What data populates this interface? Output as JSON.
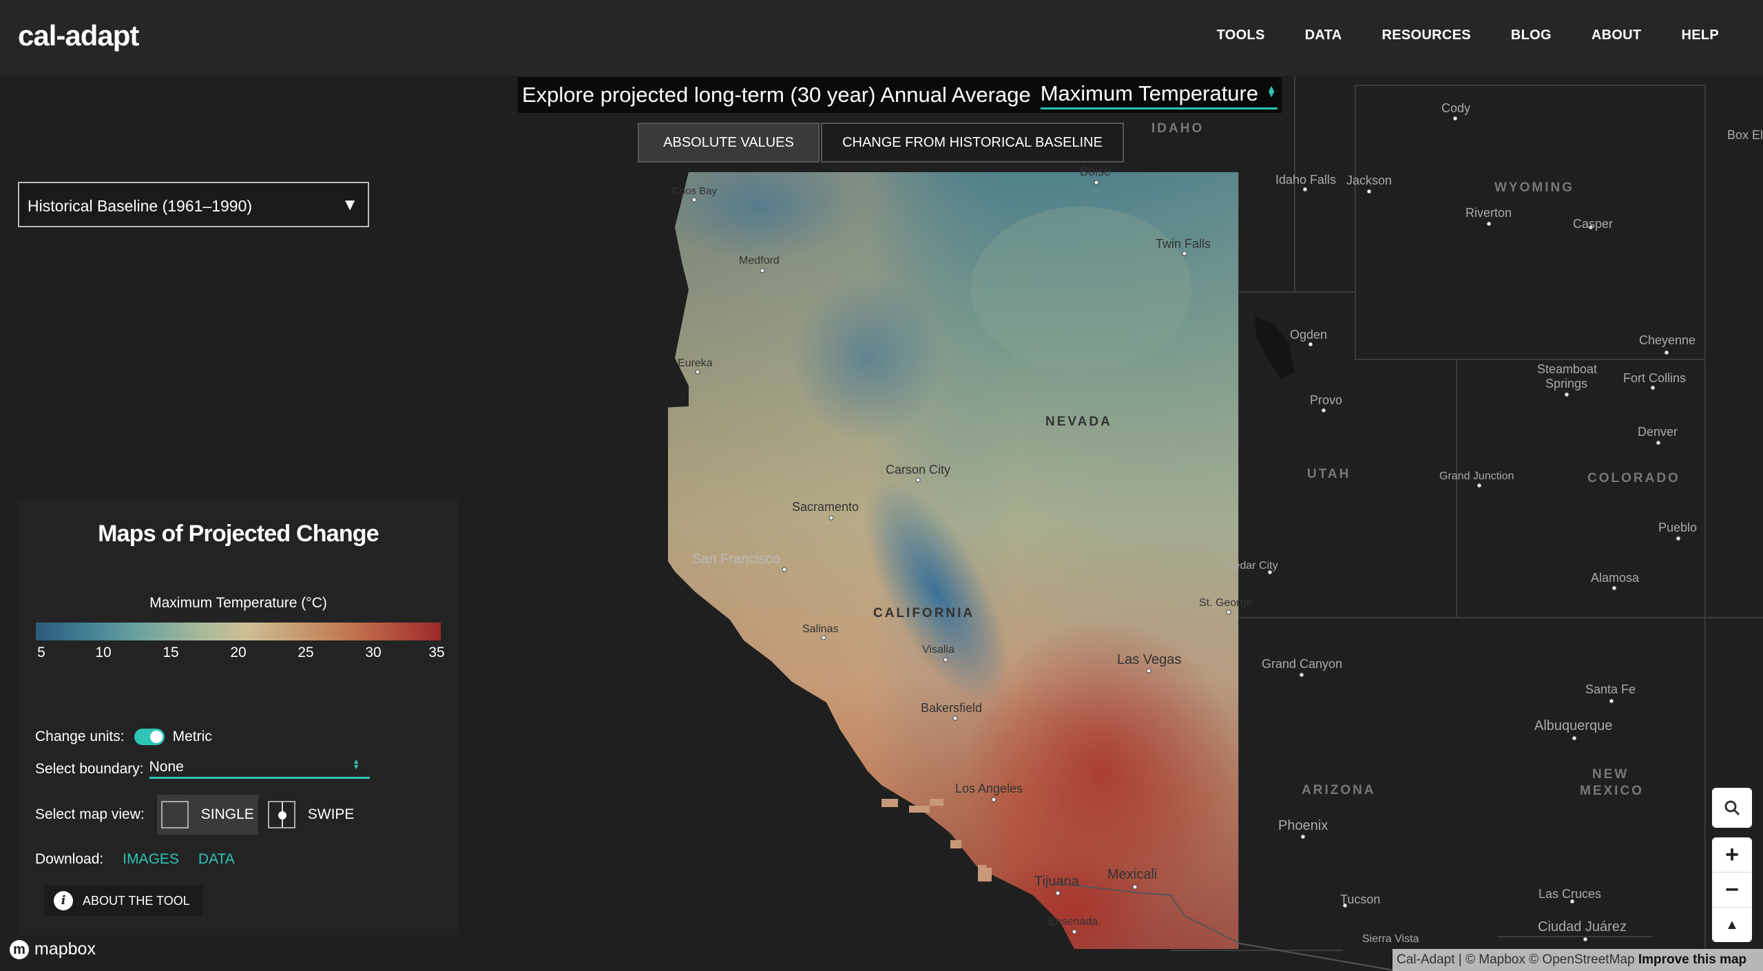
{
  "brand": {
    "logo": "cal-adapt"
  },
  "nav": [
    "TOOLS",
    "DATA",
    "RESOURCES",
    "BLOG",
    "ABOUT",
    "HELP"
  ],
  "header": {
    "explore_text": "Explore projected long-term (30 year) Annual Average",
    "variable": "Maximum Temperature"
  },
  "view_toggle": {
    "absolute": "ABSOLUTE VALUES",
    "change": "CHANGE FROM HISTORICAL BASELINE"
  },
  "period_select": {
    "value": "Historical Baseline (1961–1990)"
  },
  "panel": {
    "title": "Maps of Projected Change",
    "legend_title": "Maximum Temperature (°C)",
    "legend_ticks": [
      "5",
      "10",
      "15",
      "20",
      "25",
      "30",
      "35"
    ],
    "change_units_label": "Change units:",
    "units_value": "Metric",
    "boundary_label": "Select boundary:",
    "boundary_value": "None",
    "map_view_label": "Select map view:",
    "single_label": "SINGLE",
    "swipe_label": "SWIPE",
    "download_label": "Download:",
    "images_link": "IMAGES",
    "data_link": "DATA",
    "about_label": "ABOUT THE TOOL",
    "about_icon": "i"
  },
  "map_labels": {
    "states": [
      "IDAHO",
      "WYOMING",
      "NEVADA",
      "UTAH",
      "COLORADO",
      "CALIFORNIA",
      "ARIZONA",
      "NEW",
      "MEXICO"
    ],
    "cities": [
      "Coos Bay",
      "Medford",
      "Eureka",
      "Boise",
      "Twin Falls",
      "Idaho Falls",
      "Jackson",
      "Cody",
      "Riverton",
      "Casper",
      "Ogden",
      "Provo",
      "Cheyenne",
      "Steamboat",
      "Springs",
      "Fort Collins",
      "Denver",
      "Carson City",
      "Sacramento",
      "San Francisco",
      "Salinas",
      "Visalia",
      "Bakersfield",
      "Los Angeles",
      "Las Vegas",
      "Cedar City",
      "St. George",
      "Grand Junction",
      "Pueblo",
      "Alamosa",
      "Grand Canyon",
      "Santa Fe",
      "Albuquerque",
      "Phoenix",
      "Tucson",
      "Las Cruces",
      "Ciudad Juárez",
      "Sierra Vista",
      "Tijuana",
      "Mexicali",
      "Ensenada",
      "Box El"
    ]
  },
  "map_controls": {
    "zoom_in": "+",
    "zoom_out": "−",
    "compass": "▲"
  },
  "attribution": {
    "text": "Cal-Adapt | © Mapbox © OpenStreetMap",
    "improve": "Improve this map"
  },
  "mapbox": {
    "logo": "mapbox"
  },
  "colors": {
    "accent": "#2ec4b6",
    "background": "#1b1b1b",
    "panel": "#232323"
  }
}
